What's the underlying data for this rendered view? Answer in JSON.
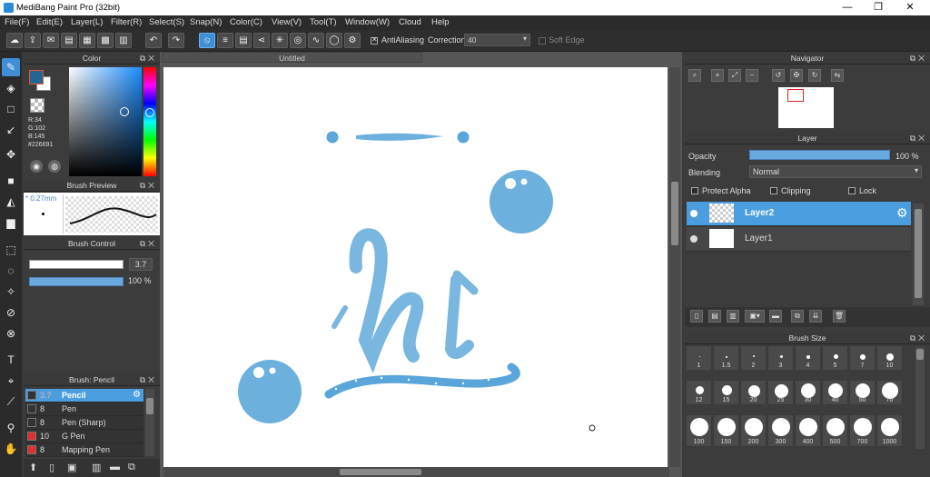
{
  "window": {
    "title": "MediBang Paint Pro (32bit)",
    "min": "—",
    "max": "❐",
    "close": "✕"
  },
  "menu": [
    "File(F)",
    "Edit(E)",
    "Layer(L)",
    "Filter(R)",
    "Select(S)",
    "Snap(N)",
    "Color(C)",
    "View(V)",
    "Tool(T)",
    "Window(W)",
    "Cloud",
    "Help"
  ],
  "toolbar": {
    "antialiasing_label": "AntiAliasing",
    "correction_label": "Correction",
    "correction_value": "40",
    "soft_edge_label": "Soft Edge"
  },
  "color_panel": {
    "title": "Color",
    "r": "R:34",
    "g": "G:102",
    "b": "B:145",
    "hex": "#226691",
    "primary": "#226691",
    "secondary": "#ffffff"
  },
  "brush_preview": {
    "title": "Brush Preview",
    "size": "* 0.27mm"
  },
  "brush_control": {
    "title": "Brush Control",
    "size_value": "3.7",
    "opacity_value": "100 %"
  },
  "brush_list": {
    "title": "Brush: Pencil",
    "items": [
      {
        "size": "3.7",
        "name": "Pencil",
        "swatch": "#333333"
      },
      {
        "size": "8",
        "name": "Pen",
        "swatch": "#333333"
      },
      {
        "size": "8",
        "name": "Pen (Sharp)",
        "swatch": "#333333"
      },
      {
        "size": "10",
        "name": "G Pen",
        "swatch": "#e03030"
      },
      {
        "size": "8",
        "name": "Mapping Pen",
        "swatch": "#e03030"
      }
    ]
  },
  "document": {
    "tab": "Untitled"
  },
  "navigator": {
    "title": "Navigator"
  },
  "layer_panel": {
    "title": "Layer",
    "opacity_label": "Opacity",
    "opacity_value": "100 %",
    "blending_label": "Blending",
    "blending_value": "Normal",
    "protect_alpha": "Protect Alpha",
    "clipping": "Clipping",
    "lock": "Lock",
    "layers": [
      {
        "name": "Layer2"
      },
      {
        "name": "Layer1"
      }
    ]
  },
  "brush_size": {
    "title": "Brush Size",
    "sizes": [
      "1",
      "1.5",
      "2",
      "3",
      "4",
      "5",
      "7",
      "10",
      "12",
      "15",
      "20",
      "25",
      "30",
      "40",
      "50",
      "70",
      "100",
      "150",
      "200",
      "300",
      "400",
      "500",
      "700",
      "1000"
    ]
  },
  "accent": "#3f8fd6"
}
